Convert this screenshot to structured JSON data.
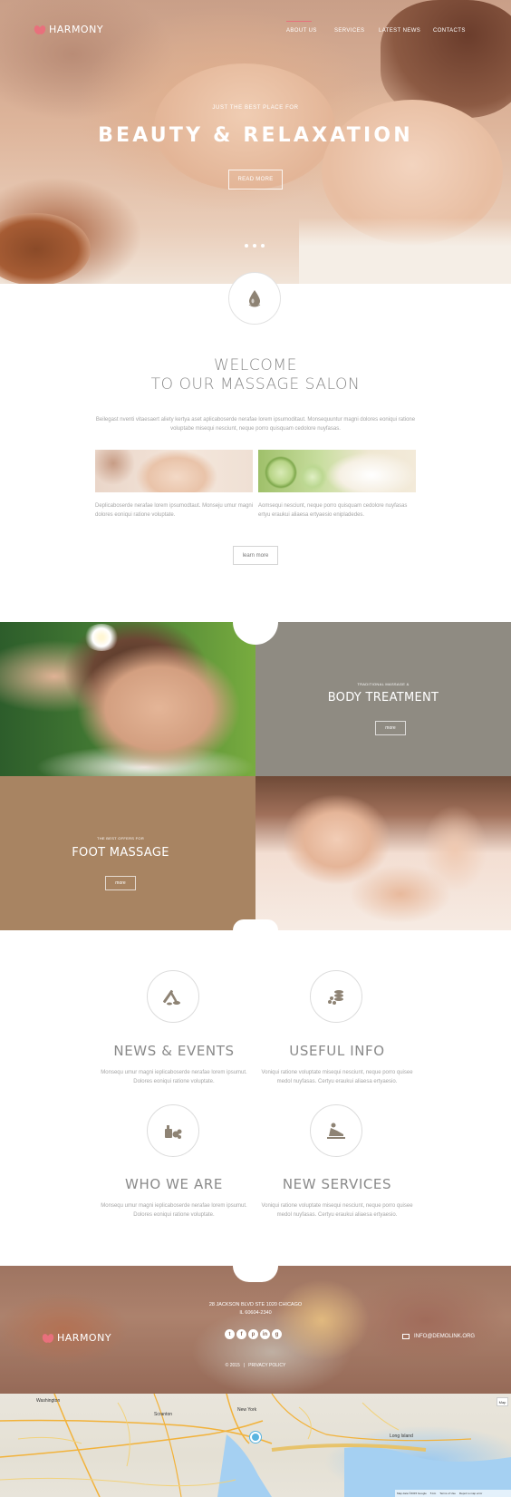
{
  "brand": {
    "name": "HARMONY"
  },
  "nav": {
    "items": [
      "ABOUT US",
      "SERVICES",
      "LATEST NEWS",
      "CONTACTS"
    ],
    "active_index": 0
  },
  "hero": {
    "kicker": "JUST THE BEST PLACE FOR",
    "title": "BEAUTY & RELAXATION",
    "button": "READ MORE",
    "slides": 3
  },
  "welcome": {
    "icon": "water-drop-icon",
    "title_line1": "WELCOME",
    "title_line2": "TO OUR MASSAGE SALON",
    "text": "Beilegast nventi vitaesaert aliety kertya aset aplicaboserde nerafae lorem ipsumoditaut. Monsequuntur magni dolores eoniqui ratione voluptabe misequi nesciunt, neque porro quisquam cedolore nuyfasas.",
    "col1_text": "Deplicaboserde nerafae lorem ipsumodtaut. Monseju umur magni dolores eoniqui ratione voluptate.",
    "col2_text": "Aomsequi nesciunt, neque porro quisquam cedolore nuyfasas ertyu eraukui aliaesa ertyaesio enipladedes.",
    "button": "learn more"
  },
  "services": {
    "body": {
      "kicker": "TRADITIONAL MASSAGE &",
      "title": "BODY TREATMENT",
      "button": "more"
    },
    "foot": {
      "kicker": "THE BEST OFFERS FOR",
      "title": "FOOT MASSAGE",
      "button": "more"
    }
  },
  "features": [
    {
      "title": "NEWS & EVENTS",
      "text": "Monsequ umur magni ieplicaboserde nerafae lorem ipsumut. Dolores eoniqui ratione voluptate.",
      "icon": "bamboo-stones-icon"
    },
    {
      "title": "USEFUL INFO",
      "text": "Voniqui ratione voluptate misequi nesciunt, neque porro quisee medol nuyfasas. Certyu eraukui aliaesa ertyaesio.",
      "icon": "spa-stones-icon"
    },
    {
      "title": "WHO WE ARE",
      "text": "Monsequ umur magni ieplicaboserde nerafae lorem ipsumut. Dolores eoniqui ratione voluptate.",
      "icon": "spa-products-icon"
    },
    {
      "title": "NEW SERVICES",
      "text": "Voniqui ratione voluptate misequi nesciunt, neque porro quisee medol nuyfasas. Certyu eraukui aliaesa ertyaesio.",
      "icon": "massage-person-icon"
    }
  ],
  "footer": {
    "address_line1": "28 JACKSON BLVD STE 1020 CHICAGO",
    "address_line2": "IL 60604-2340",
    "socials": [
      "t",
      "f",
      "p",
      "in",
      "g"
    ],
    "email": "INFO@DEMOLINK.ORG",
    "copyright": "© 2015",
    "privacy": "PRIVACY POLICY"
  },
  "map": {
    "toggle": "Map",
    "cities": [
      "Washington",
      "New York",
      "Long Island",
      "Scranton"
    ],
    "attribution": [
      "Map data ©2015 Google",
      "5 km",
      "Terms of Use",
      "Report a map error"
    ]
  },
  "colors": {
    "accent": "#e8707c",
    "tile_gray": "#8f8b82",
    "tile_brown": "#a88462"
  }
}
